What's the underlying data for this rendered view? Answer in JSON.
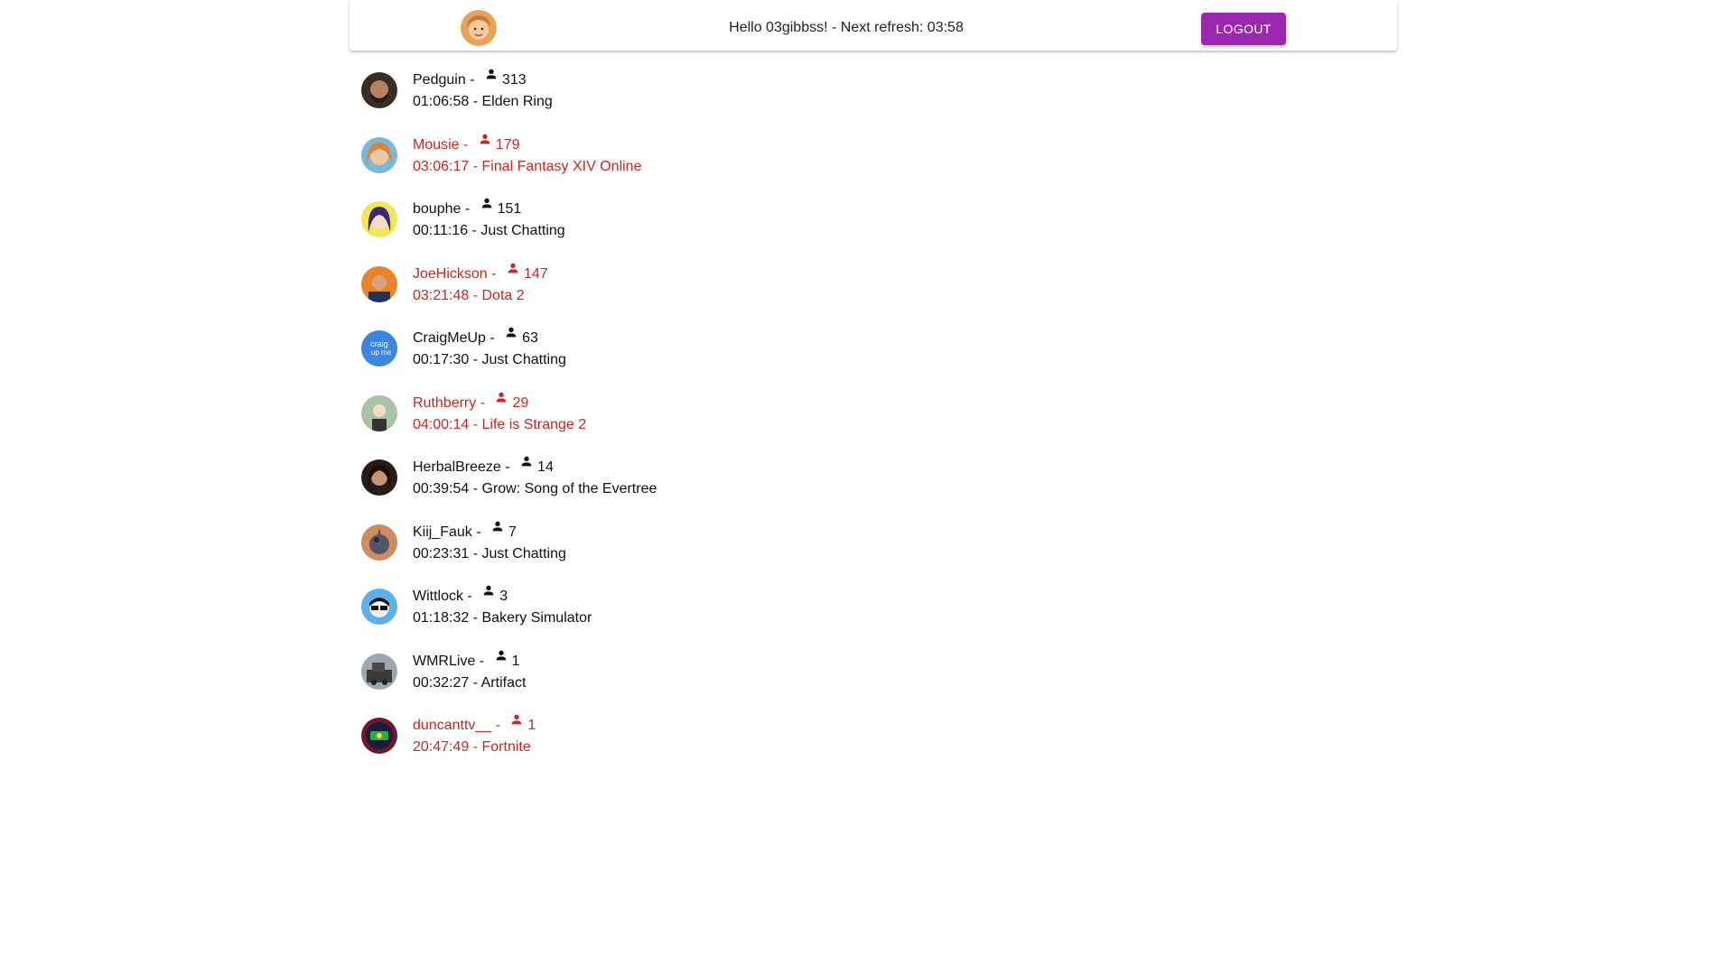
{
  "header": {
    "greeting_prefix": "Hello ",
    "username": "03gibbss",
    "greeting_mid": "! - Next refresh: ",
    "refresh_time": "03:58",
    "logout_label": "LOGOUT"
  },
  "colors": {
    "accent": "#9c27b0",
    "highlight_text": "#c62828",
    "normal_text": "#111111"
  },
  "streams": [
    {
      "name": "Pedguin",
      "viewers": "313",
      "uptime": "01:06:58",
      "game": "Elden Ring",
      "highlighted": false
    },
    {
      "name": "Mousie",
      "viewers": "179",
      "uptime": "03:06:17",
      "game": "Final Fantasy XIV Online",
      "highlighted": true
    },
    {
      "name": "bouphe",
      "viewers": "151",
      "uptime": "00:11:16",
      "game": "Just Chatting",
      "highlighted": false
    },
    {
      "name": "JoeHickson",
      "viewers": "147",
      "uptime": "03:21:48",
      "game": "Dota 2",
      "highlighted": true
    },
    {
      "name": "CraigMeUp",
      "viewers": "63",
      "uptime": "00:17:30",
      "game": "Just Chatting",
      "highlighted": false
    },
    {
      "name": "Ruthberry",
      "viewers": "29",
      "uptime": "04:00:14",
      "game": "Life is Strange 2",
      "highlighted": true
    },
    {
      "name": "HerbalBreeze",
      "viewers": "14",
      "uptime": "00:39:54",
      "game": "Grow: Song of the Evertree",
      "highlighted": false
    },
    {
      "name": "Kiij_Fauk",
      "viewers": "7",
      "uptime": "00:23:31",
      "game": "Just Chatting",
      "highlighted": false
    },
    {
      "name": "Wittlock",
      "viewers": "3",
      "uptime": "01:18:32",
      "game": "Bakery Simulator",
      "highlighted": false
    },
    {
      "name": "WMRLive",
      "viewers": "1",
      "uptime": "00:32:27",
      "game": "Artifact",
      "highlighted": false
    },
    {
      "name": "duncanttv__",
      "viewers": "1",
      "uptime": "20:47:49",
      "game": "Fortnite",
      "highlighted": true
    }
  ],
  "separator": " - ",
  "icons": {
    "viewer": "person-icon",
    "self_avatar": "user-avatar-icon"
  }
}
